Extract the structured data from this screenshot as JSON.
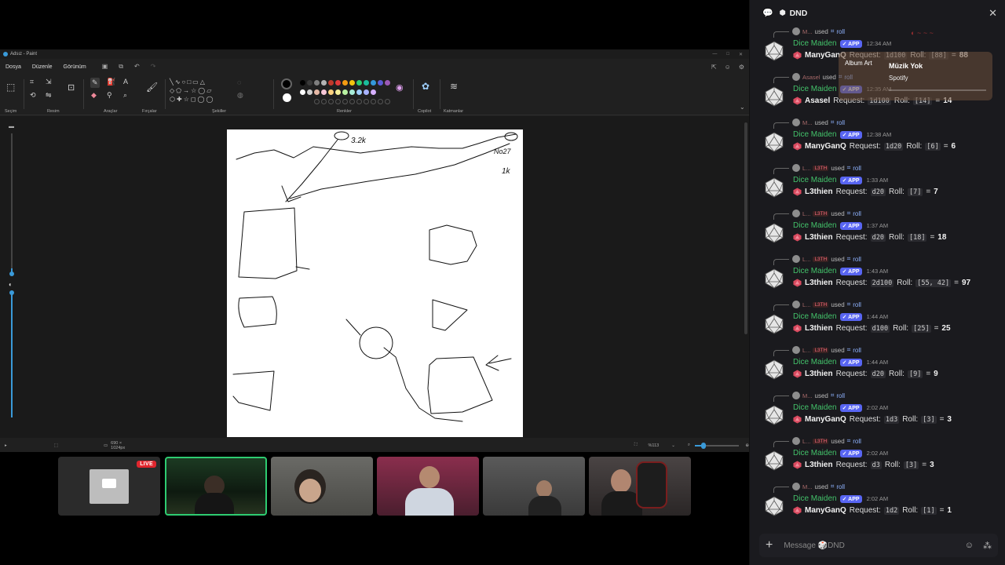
{
  "paint": {
    "title": "Adsız - Paint",
    "menu": [
      "Dosya",
      "Düzenle",
      "Görünüm"
    ],
    "groups": {
      "selection": "Seçim",
      "image": "Resim",
      "tools": "Araçlar",
      "brushes": "Fırçalar",
      "shapes": "Şekiller",
      "colors": "Renkler",
      "copilot": "Copilot",
      "layers": "Katmanlar"
    },
    "canvas_size": "690 × 1024px",
    "zoom": "%113",
    "palette": [
      "#000000",
      "#3a3a3a",
      "#7f7f7f",
      "#b4b4b4",
      "#c0392b",
      "#e03a3a",
      "#f39c12",
      "#f1c40f",
      "#2ecc71",
      "#1abc9c",
      "#3498db",
      "#5b5bd6",
      "#9b59b6",
      "#ffffff",
      "#d0d0d0",
      "#e6b9a6",
      "#f6c6d6",
      "#ffd27f",
      "#f6f19a",
      "#b8f0a0",
      "#a6ecd8",
      "#9ecfff",
      "#a7b2ff",
      "#d6b0ff"
    ]
  },
  "webcams": {
    "live_label": "LIVE",
    "tiles": [
      {
        "name": "screen-share",
        "bg": "#2b2b2b"
      },
      {
        "name": "cam-1",
        "bg": "#1f3b24"
      },
      {
        "name": "cam-2",
        "bg": "#5a5a58"
      },
      {
        "name": "cam-3",
        "bg": "#7a2f45"
      },
      {
        "name": "cam-4",
        "bg": "#4d4d4d"
      },
      {
        "name": "cam-5",
        "bg": "#3d3a3a"
      }
    ]
  },
  "discord": {
    "channel": "DND",
    "composer_placeholder": "Message 🎲DND",
    "messages": [
      {
        "reply_user": "M...",
        "reply_tag": "",
        "used": "used",
        "command": "roll",
        "author": "Dice Maiden",
        "badge": "APP",
        "time": "12:34 AM",
        "user": "ManyGanQ",
        "req_label": "Request:",
        "request": "1d100",
        "roll_label": "Roll:",
        "rolls": "[88]",
        "total": "88"
      },
      {
        "reply_user": "Asasel",
        "reply_tag": "",
        "used": "used",
        "command": "roll",
        "author": "Dice Maiden",
        "badge": "APP",
        "time": "12:35 AM",
        "user": "Asasel",
        "req_label": "Request:",
        "request": "1d100",
        "roll_label": "Roll:",
        "rolls": "[14]",
        "total": "14"
      },
      {
        "reply_user": "M...",
        "reply_tag": "",
        "used": "used",
        "command": "roll",
        "author": "Dice Maiden",
        "badge": "APP",
        "time": "12:38 AM",
        "user": "ManyGanQ",
        "req_label": "Request:",
        "request": "1d20",
        "roll_label": "Roll:",
        "rolls": "[6]",
        "total": "6"
      },
      {
        "reply_user": "L...",
        "reply_tag": "L3TH",
        "used": "used",
        "command": "roll",
        "author": "Dice Maiden",
        "badge": "APP",
        "time": "1:33 AM",
        "user": "L3thien",
        "req_label": "Request:",
        "request": "d20",
        "roll_label": "Roll:",
        "rolls": "[7]",
        "total": "7"
      },
      {
        "reply_user": "L...",
        "reply_tag": "L3TH",
        "used": "used",
        "command": "roll",
        "author": "Dice Maiden",
        "badge": "APP",
        "time": "1:37 AM",
        "user": "L3thien",
        "req_label": "Request:",
        "request": "d20",
        "roll_label": "Roll:",
        "rolls": "[18]",
        "total": "18"
      },
      {
        "reply_user": "L...",
        "reply_tag": "L3TH",
        "used": "used",
        "command": "roll",
        "author": "Dice Maiden",
        "badge": "APP",
        "time": "1:43 AM",
        "user": "L3thien",
        "req_label": "Request:",
        "request": "2d100",
        "roll_label": "Roll:",
        "rolls": "[55, 42]",
        "total": "97"
      },
      {
        "reply_user": "L...",
        "reply_tag": "L3TH",
        "used": "used",
        "command": "roll",
        "author": "Dice Maiden",
        "badge": "APP",
        "time": "1:44 AM",
        "user": "L3thien",
        "req_label": "Request:",
        "request": "d100",
        "roll_label": "Roll:",
        "rolls": "[25]",
        "total": "25"
      },
      {
        "reply_user": "L...",
        "reply_tag": "L3TH",
        "used": "used",
        "command": "roll",
        "author": "Dice Maiden",
        "badge": "APP",
        "time": "1:44 AM",
        "user": "L3thien",
        "req_label": "Request:",
        "request": "d20",
        "roll_label": "Roll:",
        "rolls": "[9]",
        "total": "9"
      },
      {
        "reply_user": "M...",
        "reply_tag": "",
        "used": "used",
        "command": "roll",
        "author": "Dice Maiden",
        "badge": "APP",
        "time": "2:02 AM",
        "user": "ManyGanQ",
        "req_label": "Request:",
        "request": "1d3",
        "roll_label": "Roll:",
        "rolls": "[3]",
        "total": "3"
      },
      {
        "reply_user": "L...",
        "reply_tag": "L3TH",
        "used": "used",
        "command": "roll",
        "author": "Dice Maiden",
        "badge": "APP",
        "time": "2:02 AM",
        "user": "L3thien",
        "req_label": "Request:",
        "request": "d3",
        "roll_label": "Roll:",
        "rolls": "[3]",
        "total": "3"
      },
      {
        "reply_user": "M...",
        "reply_tag": "",
        "used": "used",
        "command": "roll",
        "author": "Dice Maiden",
        "badge": "APP",
        "time": "2:02 AM",
        "user": "ManyGanQ",
        "req_label": "Request:",
        "request": "1d2",
        "roll_label": "Roll:",
        "rolls": "[1]",
        "total": "1"
      }
    ]
  },
  "spotify": {
    "art_label": "Album Art",
    "title": "Müzik Yok",
    "source": "Spotify"
  },
  "sketch_text": {
    "top_label": "3.2k",
    "right_label_1": "No27",
    "right_label_2": "1k"
  }
}
